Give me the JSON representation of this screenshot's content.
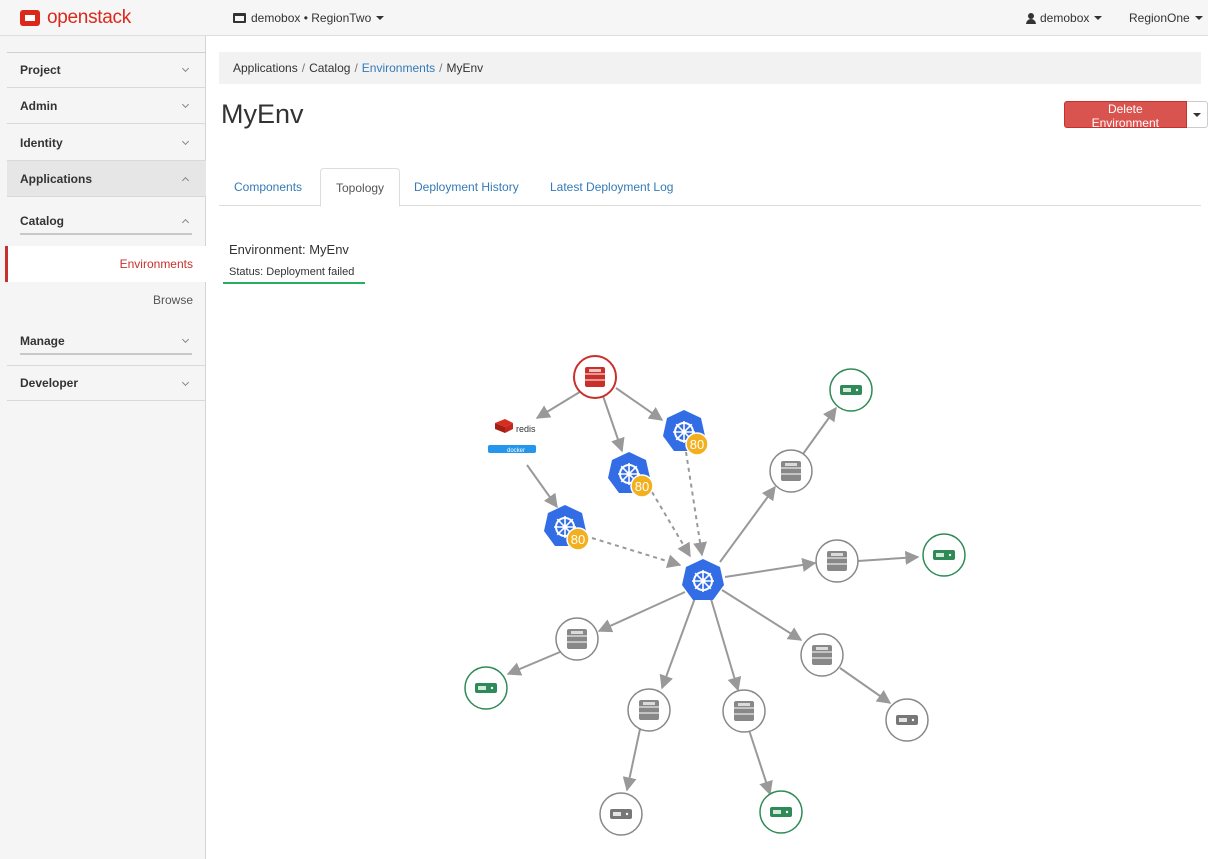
{
  "topbar": {
    "logo_text": "openstack",
    "project_switch": "demobox • RegionTwo",
    "user": "demobox",
    "region": "RegionOne"
  },
  "sidebar": {
    "project": "Project",
    "admin": "Admin",
    "identity": "Identity",
    "applications": "Applications",
    "catalog": "Catalog",
    "environments": "Environments",
    "browse": "Browse",
    "manage": "Manage",
    "developer": "Developer"
  },
  "breadcrumb": {
    "applications": "Applications",
    "catalog": "Catalog",
    "environments": "Environments",
    "current": "MyEnv",
    "separator": "/"
  },
  "page": {
    "title": "MyEnv",
    "delete_button": "Delete Environment"
  },
  "tabs": {
    "components": "Components",
    "topology": "Topology",
    "deployment_history": "Deployment History",
    "latest_log": "Latest Deployment Log"
  },
  "environment": {
    "name": "Environment: MyEnv",
    "status": "Status: Deployment failed"
  },
  "topology": {
    "redis_label": "redis",
    "docker_label": "docker",
    "kube_badge": "80",
    "colors": {
      "kube": "#326de6",
      "badge": "#f2b01e",
      "failed": "#c9302c",
      "ok": "#2e8b57",
      "neutral": "#888888"
    }
  }
}
